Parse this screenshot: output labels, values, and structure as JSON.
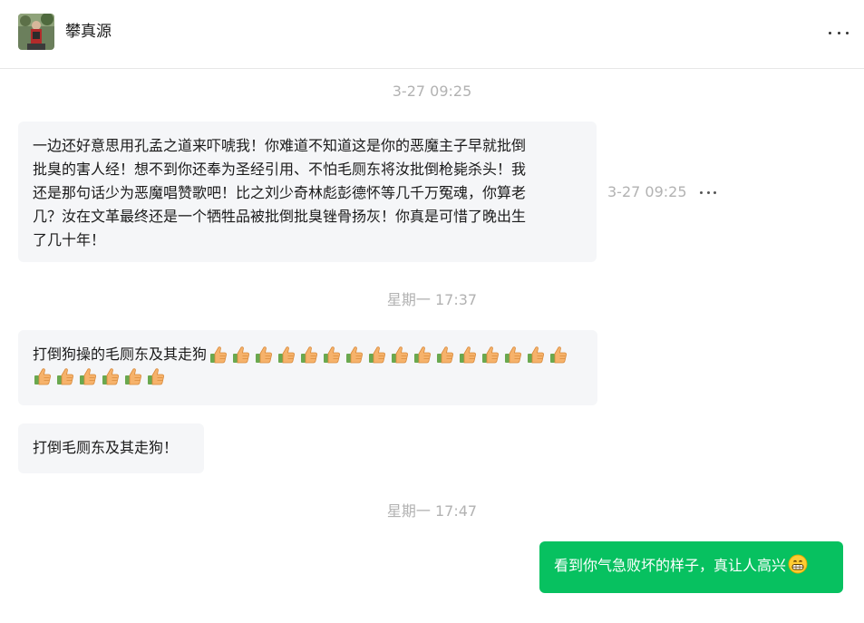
{
  "contact": {
    "name": "攀真源"
  },
  "messages": [
    {
      "time_separator": "3-27 09:25",
      "text": "一边还好意思用孔孟之道来吓唬我！你难道不知道这是你的恶魔主子早就批倒批臭的害人经！想不到你还奉为圣经引用、不怕毛厕东将汝批倒枪毙杀头！我还是那句话少为恶魔唱赞歌吧！比之刘少奇林彪彭德怀等几千万冤魂，你算老几？汝在文革最终还是一个牺牲品被批倒批臭锉骨扬灰！你真是可惜了晚出生了几十年！",
      "lines": [
        "一边还好意思用孔孟之道来吓唬我！你难道不知道这是你的恶魔主子早就批倒",
        "批臭的害人经！想不到你还奉为圣经引用、不怕毛厕东将汝批倒枪毙杀头！我",
        "还是那句话少为恶魔唱赞歌吧！比之刘少奇林彪彭德怀等几千万冤魂，你算老",
        "几？汝在文革最终还是一个牺牲品被批倒批臭锉骨扬灰！你真是可惜了晚出生",
        "了几十年！"
      ],
      "side_time": "3-27 09:25"
    },
    {
      "time_separator": "星期一 17:37",
      "text": "打倒狗操的毛厕东及其走狗",
      "thumbs_count": 22
    },
    {
      "text": "打倒毛厕东及其走狗！"
    },
    {
      "time_separator": "星期一 17:47",
      "text": "看到你气急败坏的样子，真让人高兴",
      "emoji": "grinning-face-icon"
    }
  ],
  "colors": {
    "outgoing": "#07c160",
    "incoming": "#f5f6f8",
    "timestamp": "#b2b2b2"
  }
}
